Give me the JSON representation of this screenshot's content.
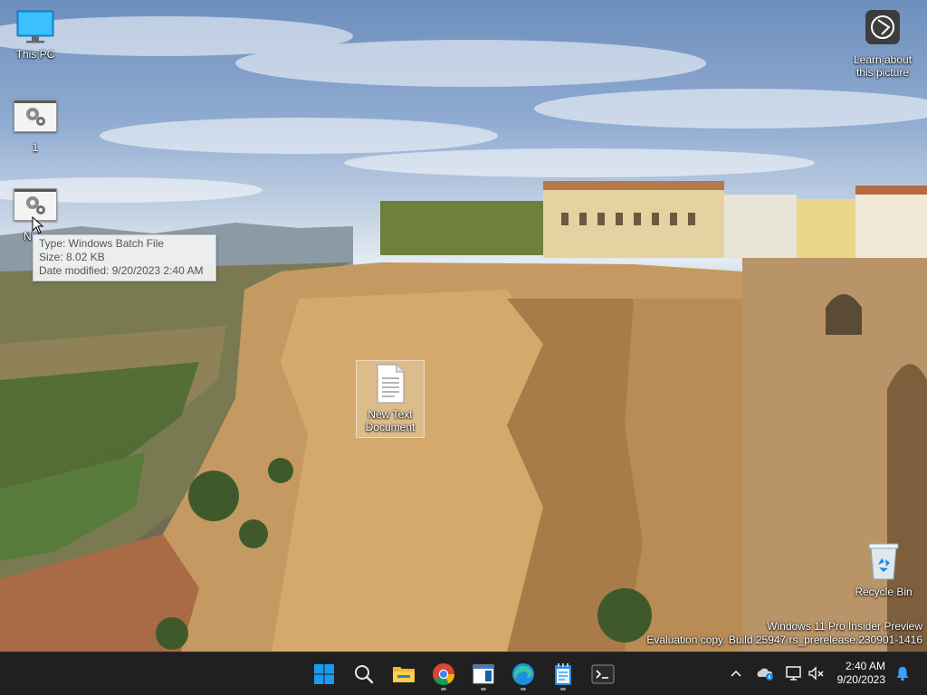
{
  "desktop": {
    "icons": [
      {
        "label": "This PC"
      },
      {
        "label": "1"
      },
      {
        "label": "N"
      },
      {
        "label": "New Text Document"
      },
      {
        "label": "Learn about this picture"
      },
      {
        "label": "Recycle Bin"
      }
    ],
    "tooltip": {
      "type": "Type: Windows Batch File",
      "size": "Size: 8.02 KB",
      "date": "Date modified: 9/20/2023 2:40 AM"
    },
    "watermark": {
      "line1": "Windows 11 Pro Insider Preview",
      "line2": "Evaluation copy. Build 25947.rs_prerelease.230901-1416"
    }
  },
  "taskbar": {
    "apps": [
      {
        "name": "start-icon"
      },
      {
        "name": "search-icon"
      },
      {
        "name": "file-explorer-icon"
      },
      {
        "name": "chrome-icon"
      },
      {
        "name": "app-window-icon"
      },
      {
        "name": "edge-icon"
      },
      {
        "name": "notepad-icon"
      },
      {
        "name": "terminal-icon"
      }
    ],
    "clock": {
      "time": "2:40 AM",
      "date": "9/20/2023"
    }
  },
  "colors": {
    "taskbar": "#202020",
    "accent": "#0078d4",
    "start_blue": "#1a9bf0"
  }
}
